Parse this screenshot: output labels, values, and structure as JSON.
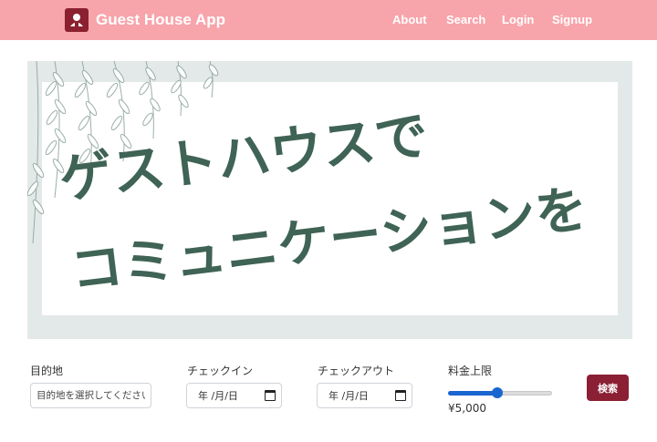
{
  "nav": {
    "brand": "Guest House App",
    "links": [
      "About",
      "Search",
      "Login",
      "Signup"
    ]
  },
  "hero": {
    "line1": "ゲストハウスで",
    "line2": "コミュニケーションを"
  },
  "search": {
    "destination_label": "目的地",
    "destination_placeholder": "目的地を選択してください",
    "checkin_label": "チェックイン",
    "checkin_value": "年 /月/日",
    "checkout_label": "チェックアウト",
    "checkout_value": "年 /月/日",
    "price_label": "料金上限",
    "price_value": "¥5,000",
    "price_fraction": 0.47,
    "button_label": "検索"
  },
  "colors": {
    "navbar": "#f8a4ab",
    "accent": "#8b2035",
    "hero_text": "#3f6355",
    "slider": "#1a66d1"
  }
}
